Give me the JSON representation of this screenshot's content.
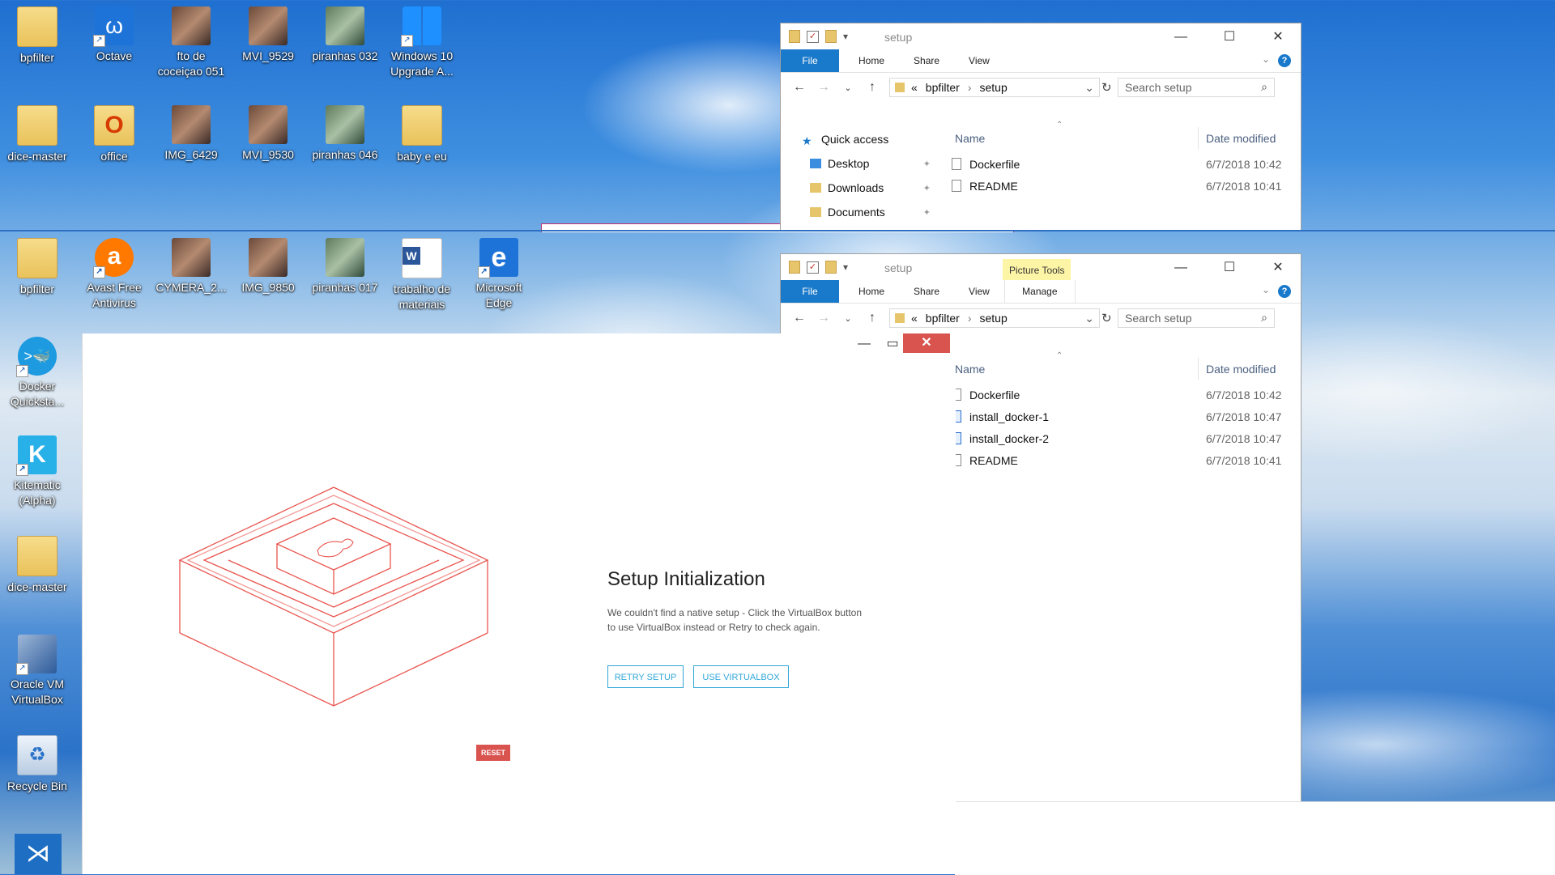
{
  "desktop_top": [
    {
      "name": "bpfilter",
      "icon": "folder-icon"
    },
    {
      "name": "Octave",
      "icon": "octave-icon"
    },
    {
      "name": "fto de coceiçao 051",
      "icon": "photo-icon"
    },
    {
      "name": "MVI_9529",
      "icon": "video-icon"
    },
    {
      "name": "piranhas 032",
      "icon": "photo-icon"
    },
    {
      "name": "Windows 10 Upgrade A...",
      "icon": "windows-upgrade-icon"
    },
    {
      "name": "dice-master",
      "icon": "folder-icon"
    },
    {
      "name": "office",
      "icon": "office-icon"
    },
    {
      "name": "IMG_6429",
      "icon": "photo-icon"
    },
    {
      "name": "MVI_9530",
      "icon": "video-icon"
    },
    {
      "name": "piranhas 046",
      "icon": "photo-icon"
    },
    {
      "name": "baby e eu",
      "icon": "folder-icon"
    }
  ],
  "desktop_bottom_row": [
    {
      "name": "bpfilter",
      "icon": "folder-icon"
    },
    {
      "name": "Avast Free Antivirus",
      "icon": "avast-icon"
    },
    {
      "name": "CYMERA_2...",
      "icon": "photo-icon"
    },
    {
      "name": "IMG_9850",
      "icon": "photo-icon"
    },
    {
      "name": "piranhas 017",
      "icon": "photo-icon"
    },
    {
      "name": "trabalho de materiais",
      "icon": "word-icon"
    },
    {
      "name": "Microsoft Edge",
      "icon": "edge-icon"
    }
  ],
  "desktop_left_column": [
    {
      "name": "Docker Quicksta...",
      "icon": "docker-icon"
    },
    {
      "name": "Kitematic (Alpha)",
      "icon": "kitematic-icon"
    },
    {
      "name": "dice-master",
      "icon": "folder-icon"
    },
    {
      "name": "Oracle VM VirtualBox",
      "icon": "virtualbox-icon"
    },
    {
      "name": "Recycle Bin",
      "icon": "recycle-bin-icon"
    }
  ],
  "explorer_top": {
    "title": "setup",
    "tabs": [
      "File",
      "Home",
      "Share",
      "View"
    ],
    "breadcrumb": {
      "sep": "«",
      "parent": "bpfilter",
      "current": "setup"
    },
    "search_placeholder": "Search setup",
    "nav": [
      {
        "label": "Quick access"
      },
      {
        "label": "Desktop"
      },
      {
        "label": "Downloads"
      },
      {
        "label": "Documents"
      }
    ],
    "columns": {
      "name": "Name",
      "date": "Date modified"
    },
    "files": [
      {
        "name": "Dockerfile",
        "date": "6/7/2018 10:42"
      },
      {
        "name": "README",
        "date": "6/7/2018 10:41"
      }
    ]
  },
  "explorer_bottom": {
    "title": "setup",
    "context_tab": "Picture Tools",
    "tabs": [
      "File",
      "Home",
      "Share",
      "View",
      "Manage"
    ],
    "breadcrumb": {
      "sep": "«",
      "parent": "bpfilter",
      "current": "setup"
    },
    "search_placeholder": "Search setup",
    "columns": {
      "name": "Name",
      "date": "Date modified"
    },
    "files": [
      {
        "name": "Dockerfile",
        "date": "6/7/2018 10:42",
        "type": "doc"
      },
      {
        "name": "install_docker-1",
        "date": "6/7/2018 10:47",
        "type": "image"
      },
      {
        "name": "install_docker-2",
        "date": "6/7/2018 10:47",
        "type": "image"
      },
      {
        "name": "README",
        "date": "6/7/2018 10:41",
        "type": "doc"
      }
    ]
  },
  "kitematic": {
    "title": "Setup Initialization",
    "description": "We couldn't find a native setup - Click the VirtualBox button to use VirtualBox instead or Retry to check again.",
    "retry_label": "RETRY SETUP",
    "virtualbox_label": "USE VIRTUALBOX",
    "reset_label": "RESET",
    "accent": "#32a7d8",
    "illustration_color": "#e9554f"
  },
  "colors": {
    "file_tab": "#1979ca",
    "context_tab": "#fdf5a6",
    "close_red": "#d9534f"
  }
}
